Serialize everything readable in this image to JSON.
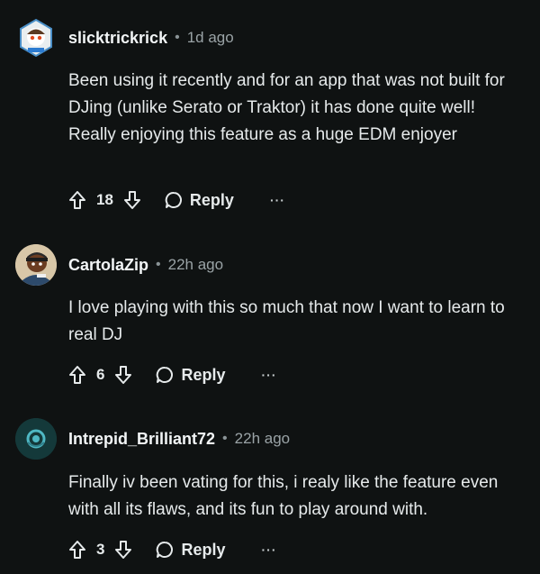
{
  "comments": [
    {
      "username": "slicktrickrick",
      "separator": "•",
      "time": "1d ago",
      "text": "Been using it recently and for an app that was not built for DJing (unlike Serato or Traktor) it has done quite well! Really enjoying this feature as a huge EDM enjoyer",
      "votes": "18",
      "reply_label": "Reply",
      "more_label": "···"
    },
    {
      "username": "CartolaZip",
      "separator": "•",
      "time": "22h ago",
      "text": "I love playing with this so much that now I want to learn to real DJ",
      "votes": "6",
      "reply_label": "Reply",
      "more_label": "···"
    },
    {
      "username": "Intrepid_Brilliant72",
      "separator": "•",
      "time": "22h ago",
      "text": "Finally iv been vating for this, i realy like the feature even with all its flaws, and its fun to play around with.",
      "votes": "3",
      "reply_label": "Reply",
      "more_label": "···"
    }
  ],
  "colors": {
    "background": "#0f1212",
    "text": "#e6eaeb",
    "muted": "#9aa3a6"
  },
  "icons": {
    "upvote": "arrow-up-outline-icon",
    "downvote": "arrow-down-outline-icon",
    "reply": "speech-bubble-icon",
    "more": "ellipsis-icon"
  }
}
